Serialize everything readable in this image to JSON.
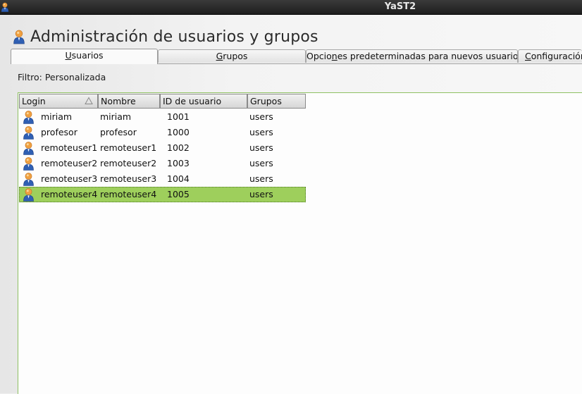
{
  "window": {
    "title": "YaST2"
  },
  "header": {
    "title": "Administración de usuarios y grupos",
    "icon": "user-icon"
  },
  "tabs": [
    {
      "label_pre": "",
      "label_key": "U",
      "label_post": "suarios",
      "active": true
    },
    {
      "label_pre": "",
      "label_key": "G",
      "label_post": "rupos",
      "active": false
    },
    {
      "label_pre": "Opcio",
      "label_key": "n",
      "label_post": "es predeterminadas para nuevos usuarios",
      "active": false
    },
    {
      "label_pre": "",
      "label_key": "C",
      "label_post": "onfiguración",
      "active": false
    }
  ],
  "filter": {
    "label": "Filtro: Personalizada"
  },
  "table": {
    "columns": [
      "Login",
      "Nombre",
      "ID de usuario",
      "Grupos"
    ],
    "sort_column": "Login",
    "rows": [
      {
        "login": "miriam",
        "name": "miriam",
        "uid": "1001",
        "groups": "users",
        "selected": false
      },
      {
        "login": "profesor",
        "name": "profesor",
        "uid": "1000",
        "groups": "users",
        "selected": false
      },
      {
        "login": "remoteuser1",
        "name": "remoteuser1",
        "uid": "1002",
        "groups": "users",
        "selected": false
      },
      {
        "login": "remoteuser2",
        "name": "remoteuser2",
        "uid": "1003",
        "groups": "users",
        "selected": false
      },
      {
        "login": "remoteuser3",
        "name": "remoteuser3",
        "uid": "1004",
        "groups": "users",
        "selected": false
      },
      {
        "login": "remoteuser4",
        "name": "remoteuser4",
        "uid": "1005",
        "groups": "users",
        "selected": true
      }
    ]
  },
  "colors": {
    "selection": "#9ecf5c",
    "frame_accent": "#8fc163",
    "titlebar": "#2a2a2a"
  }
}
